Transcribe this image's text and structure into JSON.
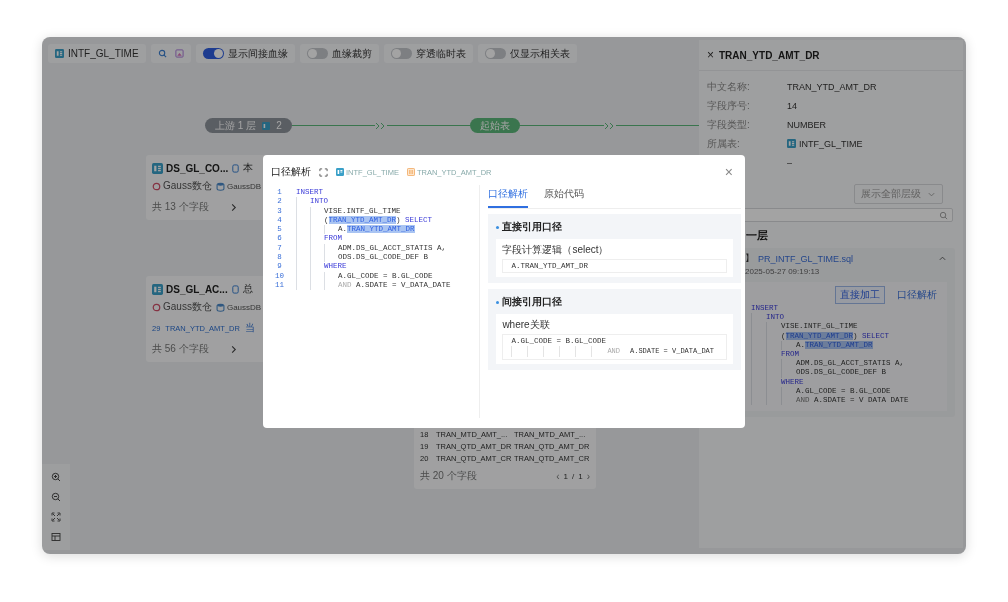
{
  "toolbar": {
    "table": "INTF_GL_TIME",
    "toggles": [
      {
        "label": "显示间接血缘",
        "on": true
      },
      {
        "label": "血缘裁剪",
        "on": false
      },
      {
        "label": "穿透临时表",
        "on": false
      },
      {
        "label": "仅显示相关表",
        "on": false
      }
    ]
  },
  "lineage": {
    "upstream": "上游 1 层",
    "upstream_count": "2",
    "start": "起始表"
  },
  "nodes": [
    {
      "title": "DS_GL_CO...",
      "note": "本",
      "tags": [
        {
          "label": "Gauss数仓",
          "kind": "warehouse"
        },
        {
          "label": "GaussDB",
          "kind": "database"
        }
      ],
      "footer": "共 13 个字段"
    },
    {
      "title": "DS_GL_AC...",
      "note": "总",
      "tags": [
        {
          "label": "Gauss数仓",
          "kind": "warehouse"
        },
        {
          "label": "GaussDB",
          "kind": "database"
        }
      ],
      "rows": [
        {
          "cells": [
            "29",
            "TRAN_YTD_AMT_DR",
            "当"
          ]
        }
      ],
      "footer": "共 56 个字段"
    }
  ],
  "field_table": {
    "rows": [
      {
        "cells": [
          "18",
          "TRAN_MTD_AMT_...",
          "TRAN_MTD_AMT_..."
        ]
      },
      {
        "cells": [
          "19",
          "TRAN_QTD_AMT_DR",
          "TRAN_QTD_AMT_DR"
        ]
      },
      {
        "cells": [
          "20",
          "TRAN_QTD_AMT_CR",
          "TRAN_QTD_AMT_CR"
        ]
      }
    ],
    "footer": "共 20 个字段",
    "pager": {
      "prev": "‹",
      "current": "1",
      "separator": "/",
      "total": "1",
      "next": "›"
    }
  },
  "detail": {
    "close": "×",
    "title": "TRAN_YTD_AMT_DR",
    "fields": [
      {
        "label": "中文名称:",
        "value": "TRAN_YTD_AMT_DR",
        "kind": "text"
      },
      {
        "label": "字段序号:",
        "value": "14",
        "kind": "text"
      },
      {
        "label": "字段类型:",
        "value": "NUMBER",
        "kind": "text"
      },
      {
        "label": "所属表:",
        "value": "INTF_GL_TIME",
        "kind": "table"
      },
      {
        "value": "–",
        "kind": "text"
      }
    ],
    "level_select": "展示全部层级",
    "layer": "一层",
    "script": {
      "bracket": "】",
      "name": "PR_INTF_GL_TIME.sql",
      "time": "2025-05-27 09:19:13",
      "expanded": true,
      "actions": [
        "直接加工",
        "口径解析"
      ],
      "code": [
        {
          "segments": [
            {
              "text": "INSERT",
              "kind": "keyword"
            }
          ]
        },
        {
          "segments": [
            {
              "text": "    INTO",
              "kind": "keyword"
            }
          ]
        },
        {
          "segments": [
            {
              "text": "        VISE.INTF_GL_TIME",
              "kind": "plain"
            }
          ]
        },
        {
          "segments": [
            {
              "text": "        (",
              "kind": "plain"
            },
            {
              "text": "TRAN_YTD_AMT_DR",
              "kind": "highlight"
            },
            {
              "text": ")",
              "kind": "plain"
            },
            {
              "text": " SELECT",
              "kind": "keyword"
            }
          ]
        },
        {
          "segments": [
            {
              "text": "            A.",
              "kind": "plain"
            },
            {
              "text": "TRAN_YTD_AMT_DR",
              "kind": "highlight"
            }
          ]
        },
        {
          "segments": [
            {
              "text": "        FROM",
              "kind": "keyword"
            }
          ]
        },
        {
          "segments": [
            {
              "text": "            ADM.DS_GL_ACCT_STATIS A,",
              "kind": "plain"
            }
          ]
        },
        {
          "segments": [
            {
              "text": "            ODS.DS_GL_CODE_DEF B",
              "kind": "plain"
            }
          ]
        },
        {
          "segments": [
            {
              "text": "        WHERE",
              "kind": "keyword"
            }
          ]
        },
        {
          "segments": [
            {
              "text": "            A.GL_CODE = B.GL_CODE",
              "kind": "plain"
            }
          ]
        },
        {
          "segments": [
            {
              "text": "            AND",
              "kind": "muted"
            },
            {
              "text": " A.SDATE = V DATA DATE",
              "kind": "plain"
            }
          ]
        }
      ]
    }
  },
  "modal": {
    "title": "口径解析",
    "table": "INTF_GL_TIME",
    "field": "TRAN_YTD_AMT_DR",
    "close": "×",
    "code": [
      {
        "number": "1",
        "segments": [
          {
            "text": "INSERT",
            "kind": "keyword"
          }
        ]
      },
      {
        "number": "2",
        "segments": [
          {
            "text": "    INTO",
            "kind": "keyword"
          }
        ]
      },
      {
        "number": "3",
        "segments": [
          {
            "text": "        VISE.INTF_GL_TIME",
            "kind": "plain"
          }
        ]
      },
      {
        "number": "4",
        "segments": [
          {
            "text": "        (",
            "kind": "plain"
          },
          {
            "text": "TRAN_YTD_AMT_DR",
            "kind": "highlight"
          },
          {
            "text": ")",
            "kind": "plain"
          },
          {
            "text": " SELECT",
            "kind": "keyword"
          }
        ]
      },
      {
        "number": "5",
        "segments": [
          {
            "text": "            A.",
            "kind": "plain"
          },
          {
            "text": "TRAN_YTD_AMT_DR",
            "kind": "highlight"
          }
        ]
      },
      {
        "number": "6",
        "segments": [
          {
            "text": "        FROM",
            "kind": "keyword"
          }
        ]
      },
      {
        "number": "7",
        "segments": [
          {
            "text": "            ADM.DS_GL_ACCT_STATIS A,",
            "kind": "plain"
          }
        ]
      },
      {
        "number": "8",
        "segments": [
          {
            "text": "            ODS.DS_GL_CODE_DEF B",
            "kind": "plain"
          }
        ]
      },
      {
        "number": "9",
        "segments": [
          {
            "text": "        WHERE",
            "kind": "keyword"
          }
        ]
      },
      {
        "number": "10",
        "segments": [
          {
            "text": "            A.GL_CODE = B.GL_CODE",
            "kind": "plain"
          }
        ]
      },
      {
        "number": "11",
        "segments": [
          {
            "text": "            AND",
            "kind": "muted"
          },
          {
            "text": " A.SDATE = V_DATA_DATE",
            "kind": "plain"
          }
        ]
      }
    ],
    "tabs": [
      {
        "label": "口径解析",
        "selected": true
      },
      {
        "label": "原始代码",
        "selected": false
      }
    ],
    "direct": {
      "heading": "直接引用口径",
      "label": "字段计算逻辑（select）",
      "value": "A.TRAN_YTD_AMT_DR"
    },
    "indirect": {
      "heading": "间接引用口径",
      "label": "where关联",
      "line1": "A.GL_CODE = B.GL_CODE",
      "line2": [
        {
          "text": "AND",
          "kind": "muted"
        },
        {
          "text": "A.SDATE = V_DATA_DAT",
          "kind": "plain"
        }
      ]
    }
  }
}
